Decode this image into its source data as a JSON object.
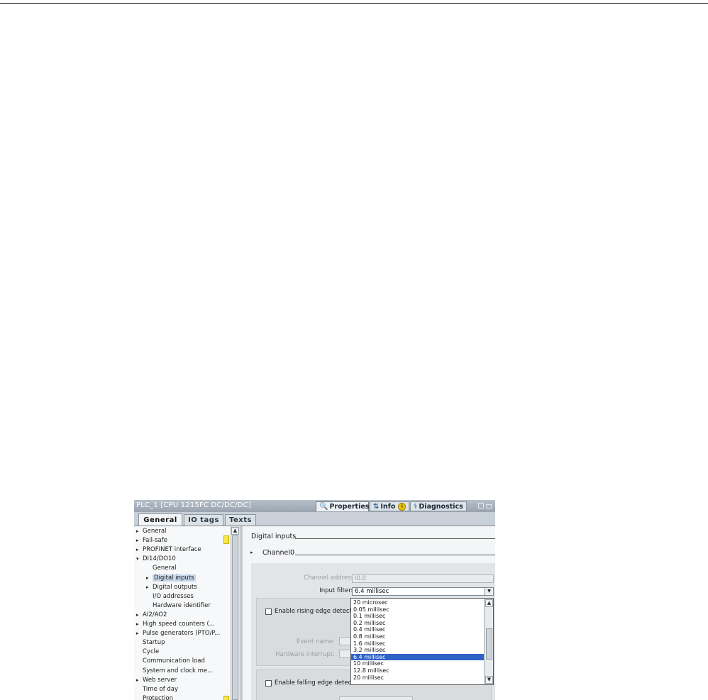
{
  "window": {
    "title": "PLC_1 [CPU 1215FC DC/DC/DC]",
    "tabs": [
      "Properties",
      "Info",
      "Diagnostics"
    ],
    "info_badge": "i"
  },
  "page_tabs": [
    "General",
    "IO tags",
    "Texts"
  ],
  "nav": {
    "items": [
      {
        "label": "General",
        "arrow": "▸"
      },
      {
        "label": "Fail-safe",
        "arrow": "▸"
      },
      {
        "label": "PROFINET interface",
        "arrow": "▸"
      },
      {
        "label": "DI14/DO10",
        "arrow": "▾"
      },
      {
        "label": "General",
        "arrow": ""
      },
      {
        "label": "Digital inputs",
        "arrow": "▸"
      },
      {
        "label": "Digital outputs",
        "arrow": "▸"
      },
      {
        "label": "I/O addresses",
        "arrow": ""
      },
      {
        "label": "Hardware identifier",
        "arrow": ""
      },
      {
        "label": "AI2/AO2",
        "arrow": "▸"
      },
      {
        "label": "High speed counters (...",
        "arrow": "▸"
      },
      {
        "label": "Pulse generators (PTO/P...",
        "arrow": "▸"
      },
      {
        "label": "Startup",
        "arrow": ""
      },
      {
        "label": "Cycle",
        "arrow": ""
      },
      {
        "label": "Communication load",
        "arrow": ""
      },
      {
        "label": "System and clock me...",
        "arrow": ""
      },
      {
        "label": "Web server",
        "arrow": "▸"
      },
      {
        "label": "Time of day",
        "arrow": ""
      },
      {
        "label": "Protection",
        "arrow": ""
      }
    ],
    "selected_index": 5
  },
  "content": {
    "section_title": "Digital inputs",
    "channel_title": "Channel0",
    "channel_arrow": "▸",
    "channel_address_label": "Channel address:",
    "channel_address_value": "I0.0",
    "input_filters_label": "Input filters:",
    "input_filters_value": "6.4 millisec",
    "rising_label": "Enable rising edge detection",
    "event_name_label": "Event name:",
    "hardware_interrupt_label": "Hardware interrupt:",
    "falling_label": "Enable falling edge detection",
    "dropdown_options": [
      "20 microsec",
      "0.05 millisec",
      "0.1 millisec",
      "0.2 millisec",
      "0.4 millisec",
      "0.8 millisec",
      "1.6 millisec",
      "3.2 millisec",
      "6.4 millisec",
      "10 millisec",
      "12.8 millisec",
      "20 millisec"
    ],
    "dropdown_selected_index": 8
  },
  "colors": {
    "selection": "#2f62c8",
    "titlebar": "#a9b3bd",
    "warning": "#f7e64a"
  }
}
